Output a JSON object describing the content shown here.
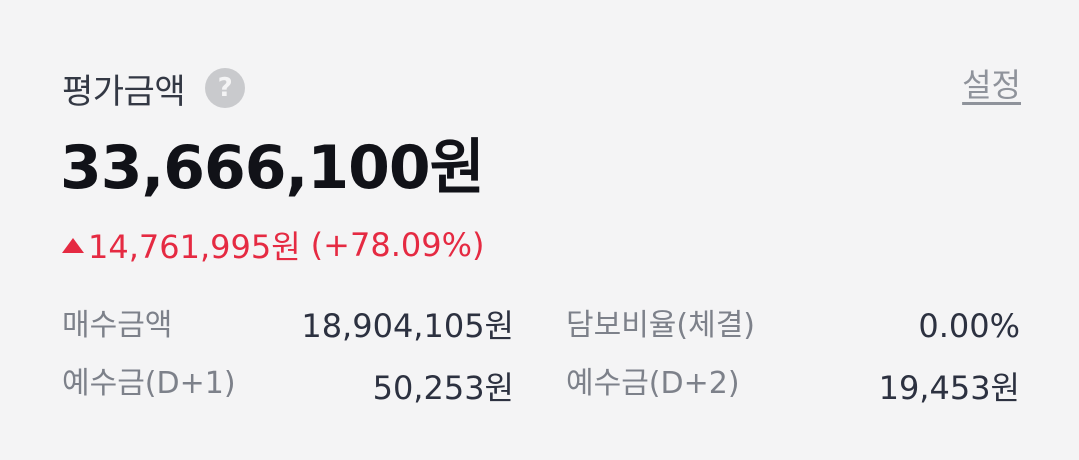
{
  "header": {
    "title": "평가금액",
    "help_icon": "question-circle-icon",
    "settings_label": "설정"
  },
  "summary": {
    "total_value": "33,666,100원",
    "change_amount": "14,761,995원",
    "change_percent": "(+78.09%)",
    "change_direction_icon": "triangle-up-icon",
    "change_color": "#e52a42"
  },
  "stats": {
    "purchase_amount_label": "매수금액",
    "purchase_amount_value": "18,904,105원",
    "collateral_ratio_label": "담보비율(체결)",
    "collateral_ratio_value": "0.00%",
    "deposit_d1_label": "예수금(D+1)",
    "deposit_d1_value": "50,253원",
    "deposit_d2_label": "예수금(D+2)",
    "deposit_d2_value": "19,453원"
  }
}
